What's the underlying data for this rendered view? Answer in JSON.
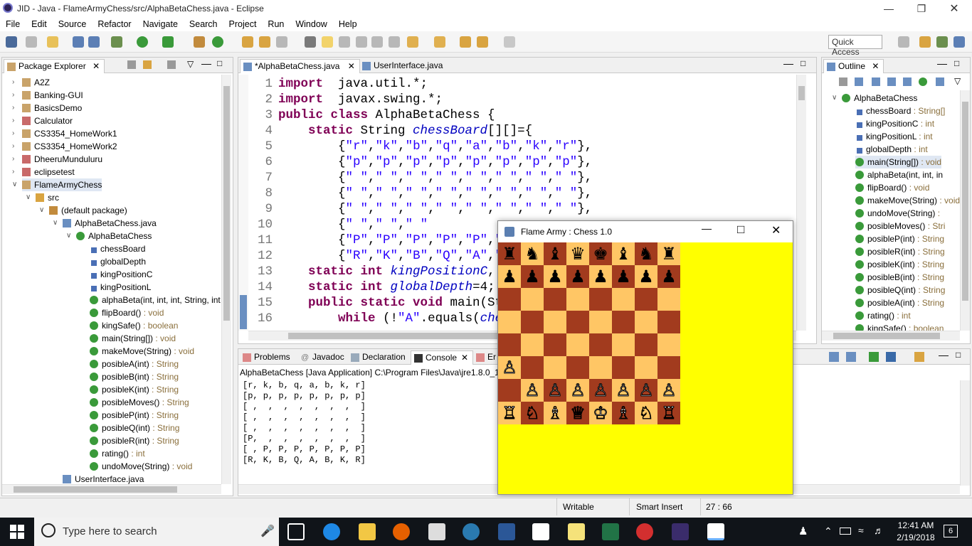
{
  "window": {
    "title": "JID - Java - FlameArmyChess/src/AlphaBetaChess.java - Eclipse"
  },
  "menu": [
    "File",
    "Edit",
    "Source",
    "Refactor",
    "Navigate",
    "Search",
    "Project",
    "Run",
    "Window",
    "Help"
  ],
  "quick_access": "Quick Access",
  "package_explorer": {
    "title": "Package Explorer",
    "rows": [
      {
        "label": "A2Z",
        "indent": 0,
        "icon": "project-icon"
      },
      {
        "label": "Banking-GUI",
        "indent": 0,
        "icon": "project-icon"
      },
      {
        "label": "BasicsDemo",
        "indent": 0,
        "icon": "project-icon"
      },
      {
        "label": "Calculator",
        "indent": 0,
        "icon": "project-error-icon"
      },
      {
        "label": "CS3354_HomeWork1",
        "indent": 0,
        "icon": "project-icon"
      },
      {
        "label": "CS3354_HomeWork2",
        "indent": 0,
        "icon": "project-icon"
      },
      {
        "label": "DheeruMunduluru",
        "indent": 0,
        "icon": "project-error-icon"
      },
      {
        "label": "eclipsetest",
        "indent": 0,
        "icon": "project-error-icon"
      },
      {
        "label": "FlameArmyChess",
        "indent": 0,
        "icon": "project-icon",
        "selected": true
      },
      {
        "label": "src",
        "indent": 1,
        "icon": "source-folder-icon"
      },
      {
        "label": "(default package)",
        "indent": 2,
        "icon": "package-icon"
      },
      {
        "label": "AlphaBetaChess.java",
        "indent": 3,
        "icon": "java-file-icon"
      },
      {
        "label": "AlphaBetaChess",
        "indent": 4,
        "icon": "class-icon"
      },
      {
        "label": "chessBoard",
        "indent": 5,
        "icon": "static-field-icon"
      },
      {
        "label": "globalDepth",
        "indent": 5,
        "icon": "static-field-icon"
      },
      {
        "label": "kingPositionC",
        "indent": 5,
        "icon": "static-field-icon"
      },
      {
        "label": "kingPositionL",
        "indent": 5,
        "icon": "static-field-icon"
      },
      {
        "label": "alphaBeta(int, int, int, String, int",
        "indent": 5,
        "icon": "method-icon"
      },
      {
        "label": "flipBoard()",
        "type": " : void",
        "indent": 5,
        "icon": "method-icon"
      },
      {
        "label": "kingSafe()",
        "type": " : boolean",
        "indent": 5,
        "icon": "method-icon"
      },
      {
        "label": "main(String[])",
        "type": " : void",
        "indent": 5,
        "icon": "method-icon"
      },
      {
        "label": "makeMove(String)",
        "type": " : void",
        "indent": 5,
        "icon": "method-icon"
      },
      {
        "label": "posibleA(int)",
        "type": " : String",
        "indent": 5,
        "icon": "method-icon"
      },
      {
        "label": "posibleB(int)",
        "type": " : String",
        "indent": 5,
        "icon": "method-icon"
      },
      {
        "label": "posibleK(int)",
        "type": " : String",
        "indent": 5,
        "icon": "method-icon"
      },
      {
        "label": "posibleMoves()",
        "type": " : String",
        "indent": 5,
        "icon": "method-icon"
      },
      {
        "label": "posibleP(int)",
        "type": " : String",
        "indent": 5,
        "icon": "method-icon"
      },
      {
        "label": "posibleQ(int)",
        "type": " : String",
        "indent": 5,
        "icon": "method-icon"
      },
      {
        "label": "posibleR(int)",
        "type": " : String",
        "indent": 5,
        "icon": "method-icon"
      },
      {
        "label": "rating()",
        "type": " : int",
        "indent": 5,
        "icon": "method-icon"
      },
      {
        "label": "undoMove(String)",
        "type": " : void",
        "indent": 5,
        "icon": "method-icon"
      },
      {
        "label": "UserInterface.java",
        "indent": 3,
        "icon": "java-file-icon"
      }
    ]
  },
  "editor": {
    "tabs": [
      "*AlphaBetaChess.java",
      "UserInterface.java"
    ],
    "lines": [
      {
        "n": "1",
        "html": [
          [
            "kw",
            "import"
          ],
          [
            "",
            "  java.util.*;"
          ]
        ]
      },
      {
        "n": "2",
        "html": [
          [
            "kw",
            "import"
          ],
          [
            "",
            "  javax.swing.*;"
          ]
        ]
      },
      {
        "n": "3",
        "html": [
          [
            "kw",
            "public class"
          ],
          [
            "",
            " AlphaBetaChess {"
          ]
        ]
      },
      {
        "n": "4",
        "html": [
          [
            "",
            "    "
          ],
          [
            "kw",
            "static"
          ],
          [
            "",
            " String "
          ],
          [
            "fld",
            "chessBoard"
          ],
          [
            "",
            "[][]={"
          ]
        ]
      },
      {
        "n": "5",
        "html": [
          [
            "",
            "        {"
          ],
          [
            "st",
            "\"r\""
          ],
          [
            "",
            ","
          ],
          [
            "st",
            "\"k\""
          ],
          [
            "",
            ","
          ],
          [
            "st",
            "\"b\""
          ],
          [
            "",
            ","
          ],
          [
            "st",
            "\"q\""
          ],
          [
            "",
            ","
          ],
          [
            "st",
            "\"a\""
          ],
          [
            "",
            ","
          ],
          [
            "st",
            "\"b\""
          ],
          [
            "",
            ","
          ],
          [
            "st",
            "\"k\""
          ],
          [
            "",
            ","
          ],
          [
            "st",
            "\"r\""
          ],
          [
            "",
            "},"
          ]
        ]
      },
      {
        "n": "6",
        "html": [
          [
            "",
            "        {"
          ],
          [
            "st",
            "\"p\""
          ],
          [
            "",
            ","
          ],
          [
            "st",
            "\"p\""
          ],
          [
            "",
            ","
          ],
          [
            "st",
            "\"p\""
          ],
          [
            "",
            ","
          ],
          [
            "st",
            "\"p\""
          ],
          [
            "",
            ","
          ],
          [
            "st",
            "\"p\""
          ],
          [
            "",
            ","
          ],
          [
            "st",
            "\"p\""
          ],
          [
            "",
            ","
          ],
          [
            "st",
            "\"p\""
          ],
          [
            "",
            ","
          ],
          [
            "st",
            "\"p\""
          ],
          [
            "",
            "},"
          ]
        ]
      },
      {
        "n": "7",
        "html": [
          [
            "",
            "        {"
          ],
          [
            "st",
            "\" \""
          ],
          [
            "",
            ","
          ],
          [
            "st",
            "\" \""
          ],
          [
            "",
            ","
          ],
          [
            "st",
            "\" \""
          ],
          [
            "",
            ","
          ],
          [
            "st",
            "\" \""
          ],
          [
            "",
            ","
          ],
          [
            "st",
            "\" \""
          ],
          [
            "",
            ","
          ],
          [
            "st",
            "\" \""
          ],
          [
            "",
            ","
          ],
          [
            "st",
            "\" \""
          ],
          [
            "",
            ","
          ],
          [
            "st",
            "\" \""
          ],
          [
            "",
            "},"
          ]
        ]
      },
      {
        "n": "8",
        "html": [
          [
            "",
            "        {"
          ],
          [
            "st",
            "\" \""
          ],
          [
            "",
            ","
          ],
          [
            "st",
            "\" \""
          ],
          [
            "",
            ","
          ],
          [
            "st",
            "\" \""
          ],
          [
            "",
            ","
          ],
          [
            "st",
            "\" \""
          ],
          [
            "",
            ","
          ],
          [
            "st",
            "\" \""
          ],
          [
            "",
            ","
          ],
          [
            "st",
            "\" \""
          ],
          [
            "",
            ","
          ],
          [
            "st",
            "\" \""
          ],
          [
            "",
            ","
          ],
          [
            "st",
            "\" \""
          ],
          [
            "",
            "},"
          ]
        ]
      },
      {
        "n": "9",
        "html": [
          [
            "",
            "        {"
          ],
          [
            "st",
            "\" \""
          ],
          [
            "",
            ","
          ],
          [
            "st",
            "\" \""
          ],
          [
            "",
            ","
          ],
          [
            "st",
            "\" \""
          ],
          [
            "",
            ","
          ],
          [
            "st",
            "\" \""
          ],
          [
            "",
            ","
          ],
          [
            "st",
            "\" \""
          ],
          [
            "",
            ","
          ],
          [
            "st",
            "\" \""
          ],
          [
            "",
            ","
          ],
          [
            "st",
            "\" \""
          ],
          [
            "",
            ","
          ],
          [
            "st",
            "\" \""
          ],
          [
            "",
            "},"
          ]
        ]
      },
      {
        "n": "10",
        "html": [
          [
            "",
            "        {"
          ],
          [
            "st",
            "\" \""
          ],
          [
            "",
            ","
          ],
          [
            "st",
            "\" \""
          ],
          [
            "",
            ","
          ],
          [
            "st",
            "\" \""
          ]
        ]
      },
      {
        "n": "11",
        "html": [
          [
            "",
            "        {"
          ],
          [
            "st",
            "\"P\""
          ],
          [
            "",
            ","
          ],
          [
            "st",
            "\"P\""
          ],
          [
            "",
            ","
          ],
          [
            "st",
            "\"P\""
          ],
          [
            "",
            ","
          ],
          [
            "st",
            "\"P\""
          ],
          [
            "",
            ","
          ],
          [
            "st",
            "\"P\""
          ],
          [
            "",
            ","
          ],
          [
            "st",
            "\"P"
          ]
        ]
      },
      {
        "n": "12",
        "html": [
          [
            "",
            "        {"
          ],
          [
            "st",
            "\"R\""
          ],
          [
            "",
            ","
          ],
          [
            "st",
            "\"K\""
          ],
          [
            "",
            ","
          ],
          [
            "st",
            "\"B\""
          ],
          [
            "",
            ","
          ],
          [
            "st",
            "\"Q\""
          ],
          [
            "",
            ","
          ],
          [
            "st",
            "\"A\""
          ],
          [
            "",
            ","
          ],
          [
            "st",
            "\"B"
          ]
        ]
      },
      {
        "n": "13",
        "html": [
          [
            "",
            "    "
          ],
          [
            "kw",
            "static int"
          ],
          [
            "fld",
            " kingPositionC"
          ],
          [
            "",
            ", "
          ],
          [
            "fld",
            "k"
          ]
        ]
      },
      {
        "n": "14",
        "html": [
          [
            "",
            "    "
          ],
          [
            "kw",
            "static int"
          ],
          [
            "fld",
            " globalDepth"
          ],
          [
            "",
            "=4;"
          ]
        ]
      },
      {
        "n": "15",
        "html": [
          [
            "",
            "    "
          ],
          [
            "kw",
            "public static void"
          ],
          [
            "",
            " main(Str"
          ]
        ]
      },
      {
        "n": "16",
        "html": [
          [
            "",
            "        "
          ],
          [
            "kw",
            "while"
          ],
          [
            "",
            " (!"
          ],
          [
            "st",
            "\"A\""
          ],
          [
            "",
            ".equals("
          ],
          [
            "fld",
            "ches"
          ]
        ]
      }
    ]
  },
  "outline": {
    "title": "Outline",
    "rows": [
      {
        "label": "AlphaBetaChess",
        "indent": 0,
        "icon": "class-icon"
      },
      {
        "label": "chessBoard",
        "type": " : String[]",
        "indent": 1,
        "icon": "static-field-icon"
      },
      {
        "label": "kingPositionC",
        "type": " : int",
        "indent": 1,
        "icon": "static-field-icon"
      },
      {
        "label": "kingPositionL",
        "type": " : int",
        "indent": 1,
        "icon": "static-field-icon"
      },
      {
        "label": "globalDepth",
        "type": " : int",
        "indent": 1,
        "icon": "static-field-icon"
      },
      {
        "label": "main(String[])",
        "type": " : void",
        "indent": 1,
        "icon": "method-icon",
        "selected": true
      },
      {
        "label": "alphaBeta(int, int, in",
        "indent": 1,
        "icon": "method-icon"
      },
      {
        "label": "flipBoard()",
        "type": " : void",
        "indent": 1,
        "icon": "method-icon"
      },
      {
        "label": "makeMove(String)",
        "type": " : void",
        "indent": 1,
        "icon": "method-icon"
      },
      {
        "label": "undoMove(String)",
        "type": " :",
        "indent": 1,
        "icon": "method-icon"
      },
      {
        "label": "posibleMoves()",
        "type": " : Stri",
        "indent": 1,
        "icon": "method-icon"
      },
      {
        "label": "posibleP(int)",
        "type": " : String",
        "indent": 1,
        "icon": "method-icon"
      },
      {
        "label": "posibleR(int)",
        "type": " : String",
        "indent": 1,
        "icon": "method-icon"
      },
      {
        "label": "posibleK(int)",
        "type": " : String",
        "indent": 1,
        "icon": "method-icon"
      },
      {
        "label": "posibleB(int)",
        "type": " : String",
        "indent": 1,
        "icon": "method-icon"
      },
      {
        "label": "posibleQ(int)",
        "type": " : String",
        "indent": 1,
        "icon": "method-icon"
      },
      {
        "label": "posibleA(int)",
        "type": " : String",
        "indent": 1,
        "icon": "method-icon"
      },
      {
        "label": "rating()",
        "type": " : int",
        "indent": 1,
        "icon": "method-icon"
      },
      {
        "label": "kingSafe()",
        "type": " : boolean",
        "indent": 1,
        "icon": "method-icon"
      }
    ]
  },
  "console": {
    "tabs": [
      "Problems",
      "Javadoc",
      "Declaration",
      "Console",
      "Er"
    ],
    "header": "AlphaBetaChess [Java Application] C:\\Program Files\\Java\\jre1.8.0_121",
    "lines": [
      "[r, k, b, q, a, b, k, r]",
      "[p, p, p, p, p, p, p, p]",
      "[ ,  ,  ,  ,  ,  ,  ,  ]",
      "[ ,  ,  ,  ,  ,  ,  ,  ]",
      "[ ,  ,  ,  ,  ,  ,  ,  ]",
      "[P,  ,  ,  ,  ,  ,  ,  ]",
      "[ , P, P, P, P, P, P, P]",
      "[R, K, B, Q, A, B, K, R]"
    ]
  },
  "chess_window": {
    "title": "Flame Army : Chess 1.0",
    "board": [
      [
        "♜",
        "♞",
        "♝",
        "♛",
        "♚",
        "♝",
        "♞",
        "♜"
      ],
      [
        "♟",
        "♟",
        "♟",
        "♟",
        "♟",
        "♟",
        "♟",
        "♟"
      ],
      [
        "",
        "",
        "",
        "",
        "",
        "",
        "",
        ""
      ],
      [
        "",
        "",
        "",
        "",
        "",
        "",
        "",
        ""
      ],
      [
        "",
        "",
        "",
        "",
        "",
        "",
        "",
        ""
      ],
      [
        "♙",
        "",
        "",
        "",
        "",
        "",
        "",
        ""
      ],
      [
        "",
        "♙",
        "♙",
        "♙",
        "♙",
        "♙",
        "♙",
        "♙"
      ],
      [
        "♖",
        "♘",
        "♗",
        "♕",
        "♔",
        "♗",
        "♘",
        "♖"
      ]
    ],
    "colors": {
      "dark": "#a23b1e",
      "light": "#ffc665",
      "background": "#ffff00"
    }
  },
  "status": {
    "writable": "Writable",
    "insert": "Smart Insert",
    "position": "27 : 66"
  },
  "taskbar": {
    "search_placeholder": "Type here to search",
    "time": "12:41 AM",
    "date": "2/19/2018",
    "notifications": "6"
  }
}
